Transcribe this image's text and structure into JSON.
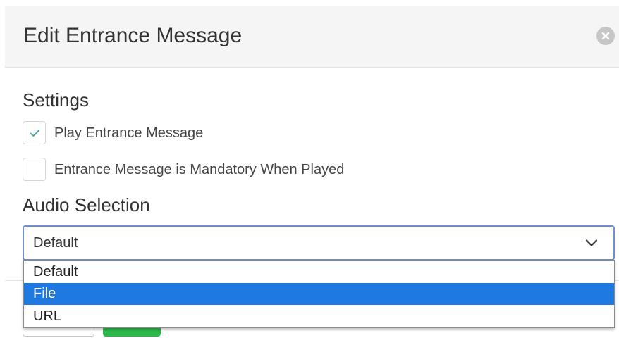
{
  "dialog": {
    "title": "Edit Entrance Message",
    "close_icon": "close-circle-icon"
  },
  "settings": {
    "heading": "Settings",
    "checkboxes": [
      {
        "label": "Play Entrance Message",
        "checked": true
      },
      {
        "label": "Entrance Message is Mandatory When Played",
        "checked": false
      }
    ]
  },
  "audio": {
    "heading": "Audio Selection",
    "selected_value": "Default",
    "options": [
      "Default",
      "File",
      "URL"
    ],
    "highlighted_option": "File"
  },
  "colors": {
    "highlight": "#1e79e0",
    "check": "#3aa6a0",
    "primary_button": "#2db84a",
    "focus_border": "#6d8fd0"
  }
}
